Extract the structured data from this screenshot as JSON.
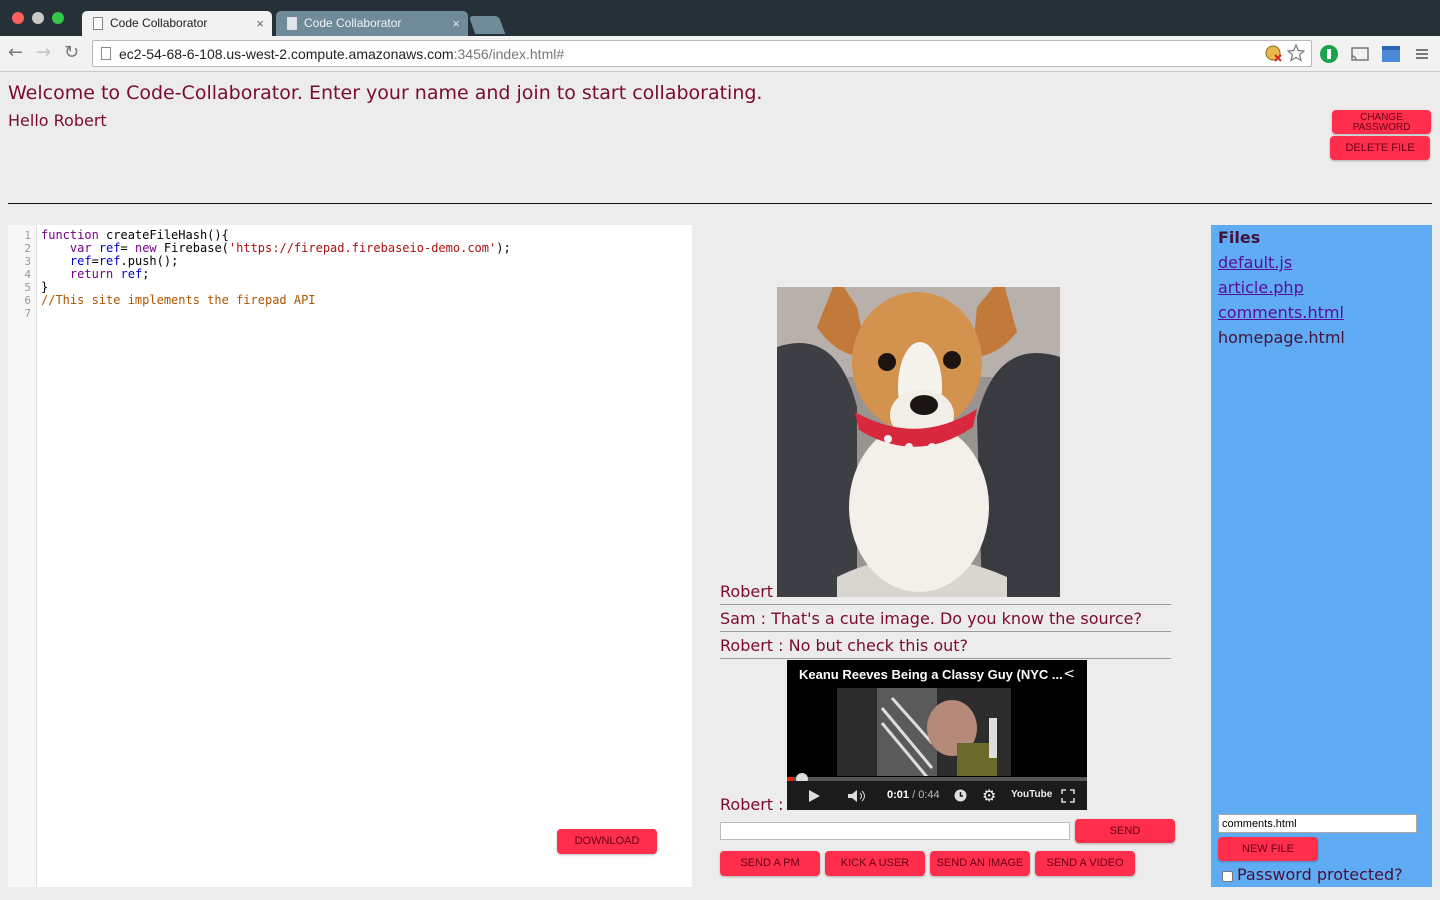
{
  "browser": {
    "tabs": [
      {
        "label": "Code Collaborator"
      },
      {
        "label": "Code Collaborator"
      }
    ],
    "close_glyph": "×",
    "url_host": "ec2-54-68-6-108.us-west-2.compute.amazonaws.com",
    "url_rest": ":3456/index.html#",
    "icons": [
      "back-icon",
      "forward-icon",
      "reload-icon",
      "page-icon",
      "blocked-extension-icon",
      "star-icon",
      "1password-icon",
      "cast-icon",
      "window-icon",
      "menu-icon"
    ]
  },
  "header": {
    "welcome": "Welcome to Code-Collaborator. Enter your name and join to start collaborating.",
    "hello": "Hello Robert",
    "change_password_line1": "CHANGE",
    "change_password_line2": "PASSWORD",
    "delete_file": "DELETE FILE"
  },
  "editor": {
    "line_numbers": [
      "1",
      "2",
      "3",
      "4",
      "5",
      "6",
      "7"
    ],
    "code": {
      "l1_kw": "function",
      "l1_rest": " createFileHash(){",
      "l2_kw": "var",
      "l2_var": "ref",
      "l2_eq": "= ",
      "l2_new": "new",
      "l2_call": " Firebase(",
      "l2_str": "'https://firepad.firebaseio-demo.com'",
      "l2_end": ");",
      "l3_var1": "ref",
      "l3_eq": "=",
      "l3_var2": "ref",
      "l3_rest": ".push();",
      "l4_kw": "return",
      "l4_var": "ref",
      "l4_end": ";",
      "l5": "}",
      "l6_comment": "//This site implements the firepad API"
    },
    "download": "DOWNLOAD"
  },
  "chat": {
    "image_sender": "Robert",
    "messages": [
      "Sam : That's a cute image. Do you know the source?",
      "Robert : No but check this out?"
    ],
    "video_sender": "Robert :",
    "video": {
      "title": "Keanu Reeves Being a Classy Guy (NYC ...",
      "time_current": "0:01",
      "time_total": " / 0:44",
      "progress": 0.02,
      "youtube_label": "YouTube"
    },
    "input_value": "",
    "send": "SEND",
    "actions": [
      "SEND A PM",
      "KICK A USER",
      "SEND AN IMAGE",
      "SEND A VIDEO"
    ]
  },
  "files": {
    "title": "Files",
    "items": [
      "default.js",
      "article.php",
      "comments.html",
      "homepage.html"
    ],
    "new_file_value": "comments.html",
    "new_file": "NEW FILE",
    "password_protected": "Password protected?",
    "password_checked": false
  },
  "colors": {
    "accent_button": "#fe2e4c",
    "text_maroon": "#7b0b2d",
    "files_panel": "#60acf4"
  }
}
